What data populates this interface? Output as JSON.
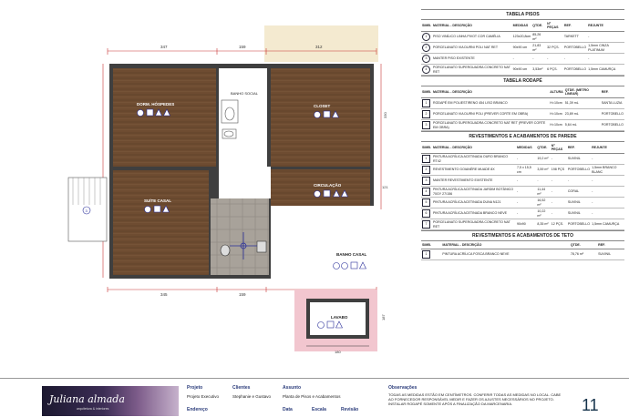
{
  "plan": {
    "dims_top": [
      "347",
      "159",
      "312"
    ],
    "dims_bottom": [
      "345",
      "159",
      "225"
    ],
    "dims_misc": [
      "225",
      "413",
      "121",
      "333",
      "330",
      "180",
      "187",
      "140",
      "216"
    ],
    "rooms": {
      "dorm": "DORM. HÓSPEDES",
      "banho_social": "BANHO SOCIAL",
      "closet": "CLOSET",
      "circulacao": "CIRCULAÇÃO",
      "suite": "SUÍTE CASAL",
      "banho_casal": "BANHO CASAL",
      "lavabo": "LAVABO"
    },
    "tag_labels": [
      "1",
      "2",
      "3",
      "4"
    ],
    "wall_tag": "3"
  },
  "tabela_pisos": {
    "title": "TABELA PISOS",
    "headers": [
      "SIMB.",
      "MATERIAL - DESCRIÇÃO",
      "MEDIDAS",
      "QTDE.",
      "Nº PEÇAS",
      "REF.",
      "REJUNTE"
    ],
    "rows": [
      {
        "simb": "1",
        "material": "PISO VINÍLICO LINHA PIVOT COR CAMÉLIA",
        "medidas": "123x20,8cm",
        "qtde": "85,26 m²",
        "pecas": "",
        "ref": "TARKETT",
        "rejunte": "-"
      },
      {
        "simb": "2",
        "material": "PORCELANATO VIA DURNI POLI NAT RET",
        "medidas": "90x90 cm",
        "qtde": "21,83 m²",
        "pecas": "32 PÇS.",
        "ref": "PORTOBELLO",
        "rejunte": "1,5mm CINZA PLATINUM"
      },
      {
        "simb": "3",
        "material": "MANTER PISO EXISTENTE",
        "medidas": "-",
        "qtde": "-",
        "pecas": "-",
        "ref": "-",
        "rejunte": "-"
      },
      {
        "simb": "4",
        "material": "PORCELANATO SUPERGUADRA CONCRETO NAT RET",
        "medidas": "90x90 cm",
        "qtde": "3,53m²",
        "pecas": "6 PÇS.",
        "ref": "PORTOBELLO",
        "rejunte": "1,5mm CAMURÇA"
      }
    ]
  },
  "tabela_rodape": {
    "title": "TABELA RODAPÉ",
    "headers": [
      "SIMB.",
      "MATERIAL - DESCRIÇÃO",
      "ALTURA",
      "QTDE. (METRO LINEAR)",
      "REF."
    ],
    "rows": [
      {
        "simb": "1",
        "material": "RODAPÉ EM POLIESTIRENO 454 LISO BRANCO",
        "altura": "H=10cm",
        "qtde": "51,39 mL",
        "ref": "SANTA LUZIA"
      },
      {
        "simb": "2",
        "material": "PORCELANATO VIA DURNI POLI (PREVER CORTE EM OBRA)",
        "altura": "H=10cm",
        "qtde": "23,89 mL",
        "ref": "PORTOBELLO"
      },
      {
        "simb": "3",
        "material": "PORCELANATO SUPERGUADRA CONCRETO NAT RET (PREVER CORTE EM OBRA)",
        "altura": "H=10cm",
        "qtde": "5,64 mL",
        "ref": "PORTOBELLO"
      }
    ]
  },
  "tabela_parede": {
    "title": "REVESTIMENTOS E ACABAMENTOS DE PAREDE",
    "headers": [
      "SIMB.",
      "MATERIAL - DESCRIÇÃO",
      "MEDIDAS",
      "QTDE.",
      "Nº PEÇAS",
      "REF.",
      "REJUNTE"
    ],
    "rows": [
      {
        "simb": "1",
        "material": "PINTURA ACRÍLICA ACETINADA OURO BRANCO RT42",
        "medidas": "-",
        "qtde": "19,2 m²",
        "pecas": "-",
        "ref": "SUVINIL",
        "rejunte": "-"
      },
      {
        "simb": "2",
        "material": "REVESTIMENTO GOIANÉRE MUADE 8X",
        "medidas": "7,5 x 15,5 cm",
        "qtde": "3,59 m²",
        "pecas": "198 PÇS",
        "ref": "PORTOBELLO",
        "rejunte": "1,5mm BRANCO BLANC"
      },
      {
        "simb": "3",
        "material": "MANTER REVESTIMENTO EXISTENTE",
        "medidas": "-",
        "qtde": "-",
        "pecas": "-",
        "ref": "-",
        "rejunte": "-"
      },
      {
        "simb": "4",
        "material": "PINTURA ACRÍLICA ACETINADA JARDIM BOTÂNICO 70GY 27/156",
        "medidas": "-",
        "qtde": "11,44 m²",
        "pecas": "-",
        "ref": "CORAL",
        "rejunte": "-"
      },
      {
        "simb": "5",
        "material": "PINTURA ACRÍLICA ACETINADA DUNA N121",
        "medidas": "-",
        "qtde": "16,52 m²",
        "pecas": "-",
        "ref": "SUVINIL",
        "rejunte": "-"
      },
      {
        "simb": "6",
        "material": "PINTURA ACRÍLICA ACETINADA BRANCO NEVE",
        "medidas": "-",
        "qtde": "10,22 m²",
        "pecas": "-",
        "ref": "SUVINIL",
        "rejunte": "-"
      },
      {
        "simb": "7",
        "material": "PORCELANATO SUPERGUADRA CONCRETO NAT RET",
        "medidas": "90x90",
        "qtde": "8,35 m²",
        "pecas": "12 PÇS.",
        "ref": "PORTOBELLO",
        "rejunte": "1,5mm CAMURÇA"
      }
    ]
  },
  "tabela_teto": {
    "title": "REVESTIMENTOS E ACABAMENTOS DE TETO",
    "headers": [
      "SIMB.",
      "MATERIAL - DESCRIÇÃO",
      "QTDE.",
      "REF."
    ],
    "rows": [
      {
        "simb": "1",
        "material": "PINTURA ACRÍLICA FOSCA BRANCO NEVE",
        "qtde": "78,76 m²",
        "ref": "SUVINIL"
      }
    ]
  },
  "titleblock": {
    "logo": "Juliana almada",
    "logo_sub": "arquitetura & interiores",
    "projeto_label": "Projeto",
    "projeto_value": "Projeto Executivo",
    "clientes_label": "Clientes",
    "clientes_value": "Stephanie e Gustavo",
    "assunto_label": "Assunto",
    "assunto_value": "Planta de Pisos e Acabamentos",
    "endereco_label": "Endereço",
    "data_label": "Data",
    "escala_label": "Escala",
    "revisao_label": "Revisão",
    "obs_label": "Observações",
    "obs_text": "TODAS AS MEDIDAS ESTÃO EM CENTÍMETROS. CONFERIR TODAS AS MEDIDAS NO LOCAL. CABE AO FORNECEDOR RESPONSÁVEL MEDIR E FAZER OS AJUSTES NECESSÁRIOS NO PROJETO. INSTALAR RODAPÉ SOMENTE APÓS A FINALIZAÇÃO DA MARCENARIA.",
    "sheet_number": "11"
  },
  "colors": {
    "wood": "#6b4a30",
    "wall": "#444444",
    "dimension_red": "#c83232",
    "marker_blue": "#2a2f9a",
    "lavabo_bg": "#f2c6cf",
    "annex_bg": "#f4ead0"
  }
}
